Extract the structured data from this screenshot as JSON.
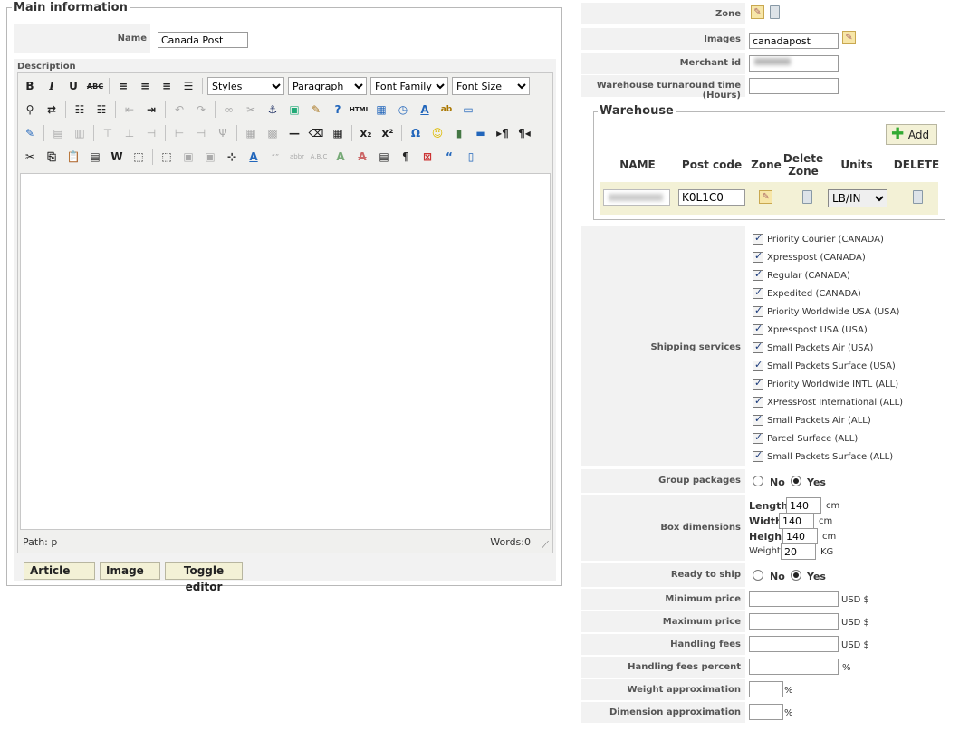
{
  "main": {
    "legend": "Main information",
    "name_label": "Name",
    "name_value": "Canada Post",
    "description_label": "Description",
    "toolbar": {
      "styles": "Styles",
      "paragraph": "Paragraph",
      "font_family": "Font Family",
      "font_size": "Font Size"
    },
    "status_path": "Path: p",
    "status_words": "Words:0",
    "buttons": {
      "article": "Article",
      "image": "Image",
      "toggle": "Toggle editor"
    }
  },
  "right": {
    "zone_label": "Zone",
    "images_label": "Images",
    "images_value": "canadapost",
    "merchant_label": "Merchant id",
    "turnaround_label": "Warehouse turnaround time (Hours)",
    "warehouse": {
      "legend": "Warehouse",
      "add_label": "Add",
      "headers": [
        "NAME",
        "Post code",
        "Zone",
        "Delete\nZone",
        "Units",
        "DELETE"
      ],
      "row": {
        "post_code": "K0L1C0",
        "units": "LB/IN"
      }
    },
    "shipping_label": "Shipping services",
    "services": [
      "Priority Courier (CANADA)",
      "Xpresspost (CANADA)",
      "Regular (CANADA)",
      "Expedited (CANADA)",
      "Priority Worldwide USA (USA)",
      "Xpresspost USA (USA)",
      "Small Packets Air (USA)",
      "Small Packets Surface (USA)",
      "Priority Worldwide INTL (ALL)",
      "XPressPost International (ALL)",
      "Small Packets Air (ALL)",
      "Parcel Surface (ALL)",
      "Small Packets Surface (ALL)"
    ],
    "group_label": "Group packages",
    "no": "No",
    "yes": "Yes",
    "box_label": "Box dimensions",
    "length_label": "Length",
    "length_value": "140",
    "width_label": "Width",
    "width_value": "140",
    "height_label": "Height",
    "height_value": "140",
    "weight_label": "Weight",
    "weight_value": "20",
    "cm": "cm",
    "kg": "KG",
    "ready_label": "Ready to ship",
    "min_price_label": "Minimum price",
    "max_price_label": "Maximum price",
    "handling_label": "Handling fees",
    "handling_pct_label": "Handling fees percent",
    "weight_approx_label": "Weight approximation",
    "dim_approx_label": "Dimension approximation",
    "usd": "USD $",
    "pct": "%"
  }
}
